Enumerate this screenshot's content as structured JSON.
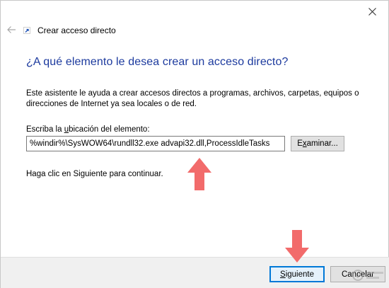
{
  "window": {
    "title": "Crear acceso directo"
  },
  "heading": "¿A qué elemento le desea crear un acceso directo?",
  "description": "Este asistente le ayuda a crear accesos directos a programas, archivos, carpetas, equipos o direcciones de Internet ya sea locales o de red.",
  "location": {
    "label_pre": "Escriba la ",
    "label_accel": "u",
    "label_post": "bicación del elemento:",
    "value": "%windir%\\SysWOW64\\rundll32.exe advapi32.dll,ProcessIdleTasks",
    "browse_pre": "E",
    "browse_accel": "x",
    "browse_post": "aminar..."
  },
  "hint": "Haga clic en Siguiente para continuar.",
  "buttons": {
    "next_pre": "",
    "next_accel": "S",
    "next_post": "iguiente",
    "cancel": "Cancelar"
  },
  "colors": {
    "heading": "#1c3a9e",
    "annotation_arrow": "#f26b6b",
    "default_button_border": "#0078d7"
  },
  "icons": [
    "close-icon",
    "back-arrow-icon",
    "shortcut-icon"
  ]
}
